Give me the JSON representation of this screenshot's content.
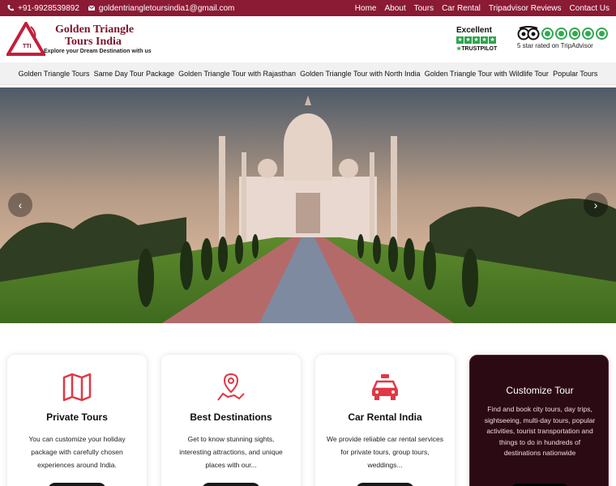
{
  "topbar": {
    "phone": "+91-9928539892",
    "email": "goldentriangletoursindia1@gmail.com",
    "nav": [
      "Home",
      "About",
      "Tours",
      "Car Rental",
      "Tripadvisor Reviews",
      "Contact Us"
    ]
  },
  "header": {
    "brand_line1": "Golden Triangle",
    "brand_line2": "Tours India",
    "tagline": "Explore your Dream Destination with us",
    "logo_mark_text": "GTTI",
    "trustpilot": {
      "rating_word": "Excellent",
      "brand": "TRUSTPILOT"
    },
    "tripadvisor": {
      "text": "5 star rated on TripAdvisor"
    }
  },
  "mainnav": [
    "Golden Triangle Tours",
    "Same Day Tour Package",
    "Golden Triangle Tour with Rajasthan",
    "Golden Triangle Tour with North India",
    "Golden Triangle Tour with Wildlife Tour",
    "Popular Tours"
  ],
  "hero": {
    "prev": "‹",
    "next": "›"
  },
  "cards": [
    {
      "title": "Private Tours",
      "desc": "You can customize your holiday package with carefully chosen experiences around India.",
      "icon": "map-icon"
    },
    {
      "title": "Best Destinations",
      "desc": "Get to know stunning sights, interesting attractions, and unique places with our...",
      "icon": "location-route-icon"
    },
    {
      "title": "Car Rental India",
      "desc": "We provide reliable car rental services for private tours, group tours, weddings...",
      "icon": "car-icon"
    },
    {
      "title": "Customize Tour",
      "desc": "Find and book city tours, day trips, sightseeing, multi-day tours, popular activities, tourist transportation and things to do in hundreds of destinations nationwide"
    }
  ],
  "colors": {
    "brand": "#8b1a34",
    "accent": "#e23744",
    "trustpilot": "#2ea44f",
    "tripadvisor": "#34a853"
  }
}
